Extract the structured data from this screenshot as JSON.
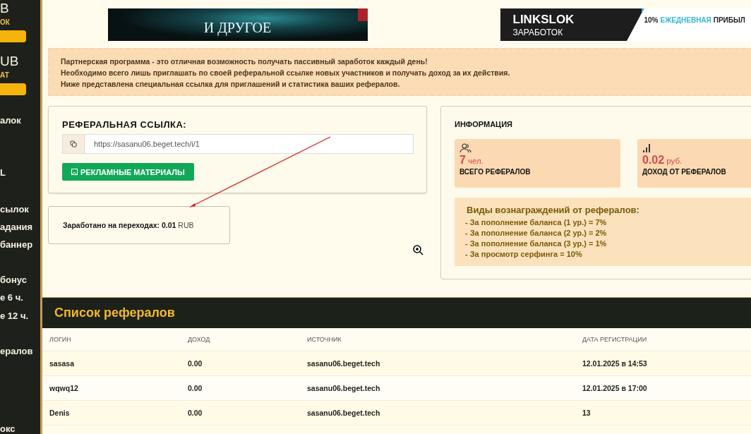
{
  "sidebar": {
    "items": [
      {
        "kind": "heading",
        "text": "B"
      },
      {
        "kind": "sub",
        "text": "ОК"
      },
      {
        "kind": "button"
      },
      {
        "kind": "heading",
        "text": "UB"
      },
      {
        "kind": "sub",
        "text": "АТ"
      },
      {
        "kind": "button"
      },
      {
        "kind": "link",
        "text": "алок"
      },
      {
        "kind": "link",
        "text": "L"
      },
      {
        "kind": "link",
        "text": "сылок"
      },
      {
        "kind": "link",
        "text": "адания"
      },
      {
        "kind": "link",
        "text": "баннер"
      },
      {
        "kind": "link",
        "text": "бонус"
      },
      {
        "kind": "link",
        "text": "е 6 ч."
      },
      {
        "kind": "link",
        "text": "е 12 ч."
      },
      {
        "kind": "link",
        "text": "ералов"
      },
      {
        "kind": "link",
        "text": "окс"
      }
    ]
  },
  "banners": [
    {
      "kind": "art",
      "text": "И ДРУГОЕ"
    },
    {
      "kind": "promo",
      "title": "LINKSLOK",
      "subtitle": "ЗАРАБОТОК",
      "slogan": [
        {
          "text": "10%",
          "accent": false
        },
        {
          "text": "ЕЖЕДНЕВНАЯ",
          "accent": true
        },
        {
          "text": "ПРИБЫЛ",
          "accent": false
        }
      ]
    }
  ],
  "notice": [
    "Партнерская программа - это отличная возможность получать пассивный заработок каждый день!",
    "Необходимо всего лишь приглашать по своей реферальной ссылке новых участников и получать доход за их действия.",
    "Ниже представлена специальная ссылка для приглашений и статистика ваших рефералов."
  ],
  "referral": {
    "title": "РЕФЕРАЛЬНАЯ ССЫЛКА:",
    "link": "https://sasanu06.beget.tech/i/1",
    "button": "РЕКЛАМНЫЕ МАТЕРИАЛЫ"
  },
  "earned": {
    "label": "Заработано на переходах:",
    "value": "0.01",
    "unit": "RUB"
  },
  "info": {
    "title": "ИНФОРМАЦИЯ",
    "stats": [
      {
        "kind": "people",
        "value": "7",
        "unit": "чел.",
        "label": "ВСЕГО РЕФЕРАЛОВ"
      },
      {
        "kind": "bars",
        "value": "0.02",
        "unit": "руб.",
        "label": "ДОХОД ОТ РЕФЕРАЛОВ"
      }
    ],
    "rewards_title": "Виды вознаграждений от рефералов:",
    "rewards": [
      "- За пополнение баланса (1 ур.) = 7%",
      "- За пополнение баланса (2 ур.) = 2%",
      "- За пополнение баланса (3 ур.) = 1%",
      "- За просмотр серфинга = 10%"
    ]
  },
  "referrals": {
    "title": "Список рефералов",
    "columns": [
      "ЛОГИН",
      "ДОХОД",
      "ИСТОЧНИК",
      "ДАТА РЕГИСТРАЦИИ"
    ],
    "rows": [
      [
        "sasasa",
        "0.00",
        "sasanu06.beget.tech",
        "12.01.2025 в 14:53"
      ],
      [
        "wqwq12",
        "0.00",
        "sasanu06.beget.tech",
        "12.01.2025 в 17:00"
      ],
      [
        "Denis",
        "0.00",
        "sasanu06.beget.tech",
        "13"
      ]
    ]
  }
}
